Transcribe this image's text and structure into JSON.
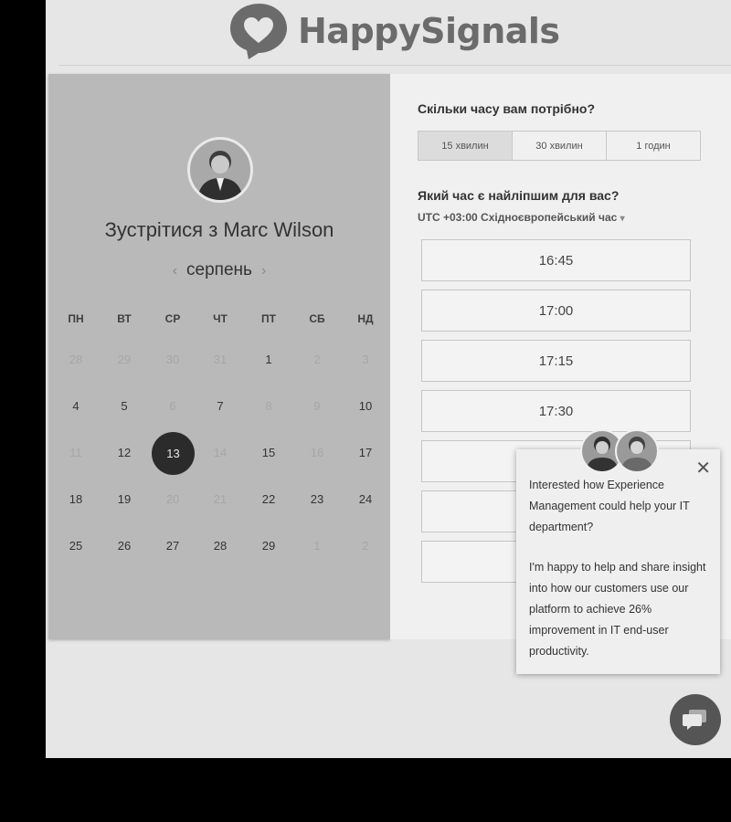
{
  "brand": {
    "name": "HappySignals"
  },
  "left": {
    "title": "Зустрітися з Marc Wilson",
    "month": "серпень",
    "prev_icon": "‹",
    "next_icon": "›",
    "weekdays": [
      "ПН",
      "ВТ",
      "СР",
      "ЧТ",
      "ПТ",
      "СБ",
      "НД"
    ],
    "weeks": [
      [
        {
          "d": "28",
          "s": "dim"
        },
        {
          "d": "29",
          "s": "dim"
        },
        {
          "d": "30",
          "s": "dim"
        },
        {
          "d": "31",
          "s": "dim"
        },
        {
          "d": "1",
          "s": "avail"
        },
        {
          "d": "2",
          "s": "dim"
        },
        {
          "d": "3",
          "s": "dim"
        }
      ],
      [
        {
          "d": "4",
          "s": "avail"
        },
        {
          "d": "5",
          "s": "avail"
        },
        {
          "d": "6",
          "s": "dim"
        },
        {
          "d": "7",
          "s": "avail"
        },
        {
          "d": "8",
          "s": "dim"
        },
        {
          "d": "9",
          "s": "dim"
        },
        {
          "d": "10",
          "s": "avail"
        }
      ],
      [
        {
          "d": "11",
          "s": "dim"
        },
        {
          "d": "12",
          "s": "avail"
        },
        {
          "d": "13",
          "s": "sel"
        },
        {
          "d": "14",
          "s": "dim"
        },
        {
          "d": "15",
          "s": "avail"
        },
        {
          "d": "16",
          "s": "dim"
        },
        {
          "d": "17",
          "s": "avail"
        }
      ],
      [
        {
          "d": "18",
          "s": "avail"
        },
        {
          "d": "19",
          "s": "avail"
        },
        {
          "d": "20",
          "s": "dim"
        },
        {
          "d": "21",
          "s": "dim"
        },
        {
          "d": "22",
          "s": "avail"
        },
        {
          "d": "23",
          "s": "avail"
        },
        {
          "d": "24",
          "s": "avail"
        }
      ],
      [
        {
          "d": "25",
          "s": "avail"
        },
        {
          "d": "26",
          "s": "avail"
        },
        {
          "d": "27",
          "s": "avail"
        },
        {
          "d": "28",
          "s": "avail"
        },
        {
          "d": "29",
          "s": "avail"
        },
        {
          "d": "1",
          "s": "dim"
        },
        {
          "d": "2",
          "s": "dim"
        }
      ]
    ]
  },
  "right": {
    "duration_question": "Скільки часу вам потрібно?",
    "durations": [
      "15 хвилин",
      "30 хвилин",
      "1 годин"
    ],
    "time_question": "Який час є найліпшим для вас?",
    "timezone": "UTC +03:00 Східноєвропейський час",
    "timezone_caret": "▾",
    "slots": [
      "16:45",
      "17:00",
      "17:15",
      "17:30",
      "",
      "",
      ""
    ]
  },
  "chat": {
    "close": "✕",
    "message_1": "Interested how Experience Management could help your IT department?",
    "message_2": "I'm happy to help and share insight into how our customers use our platform to achieve 26% improvement in IT end-user productivity."
  },
  "icons": [
    "heart-chat-logo-icon",
    "chevron-left-icon",
    "chevron-right-icon",
    "caret-down-icon",
    "close-icon",
    "chat-bubble-icon"
  ],
  "colors": {
    "selected_day": "#2b2b2b",
    "left_panel": "#b9b9b9",
    "logo": "#6b6b6b"
  }
}
